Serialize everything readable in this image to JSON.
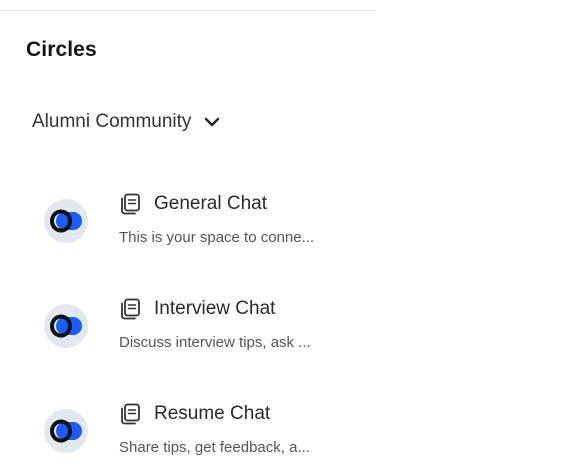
{
  "panel": {
    "title": "Circles",
    "community": {
      "label": "Alumni Community",
      "chevron_icon": "chevron-down-icon"
    }
  },
  "circles": [
    {
      "name": "General Chat",
      "description": "This is your space to conne...",
      "type_icon": "document-icon",
      "avatar_icon": "circle-logo-icon"
    },
    {
      "name": "Interview Chat",
      "description": "Discuss interview tips, ask ...",
      "type_icon": "document-icon",
      "avatar_icon": "circle-logo-icon"
    },
    {
      "name": "Resume Chat",
      "description": "Share tips, get feedback, a...",
      "type_icon": "document-icon",
      "avatar_icon": "circle-logo-icon"
    }
  ],
  "colors": {
    "brand_blue": "#1a5cff",
    "logo_dark": "#111111",
    "avatar_bg": "#e3e7ef"
  }
}
